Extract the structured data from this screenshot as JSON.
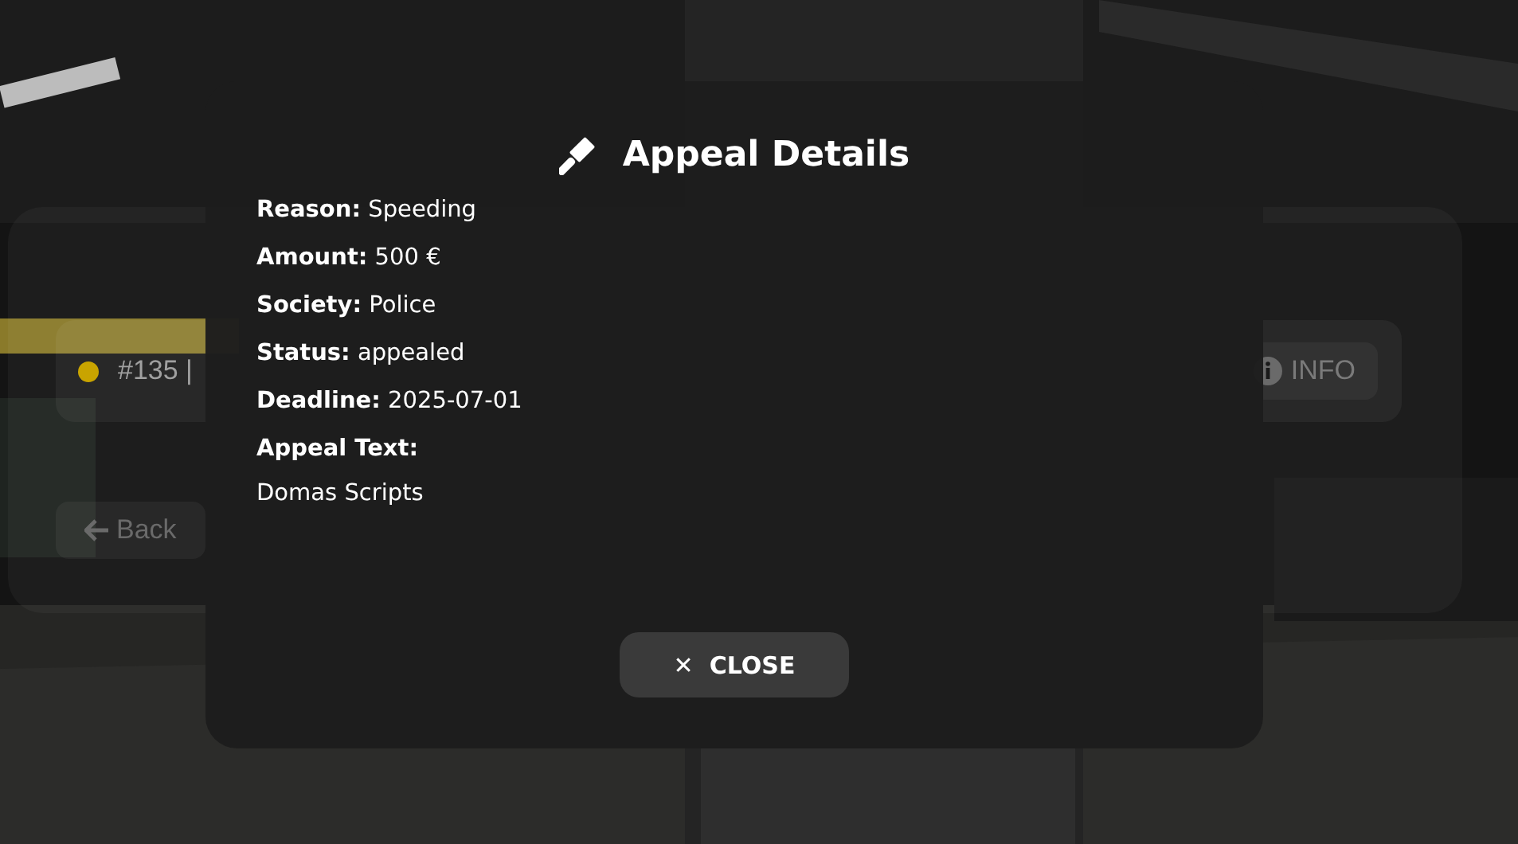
{
  "background_panel": {
    "appeals": [
      {
        "text": "#135 |",
        "color": "#c9a400",
        "button": "INFO"
      }
    ],
    "back_button": "Back"
  },
  "modal": {
    "title": "Appeal Details",
    "fields": [
      {
        "kind": "inline",
        "label": "Reason:",
        "value": "Speeding"
      },
      {
        "kind": "inline",
        "label": "Amount:",
        "value": "500 €"
      },
      {
        "kind": "inline",
        "label": "Society:",
        "value": "Police"
      },
      {
        "kind": "inline",
        "label": "Status:",
        "value": "appealed"
      },
      {
        "kind": "inline",
        "label": "Deadline:",
        "value": "2025-07-01"
      },
      {
        "kind": "block",
        "label": "Appeal Text:",
        "value": "Domas Scripts"
      }
    ],
    "close_button": {
      "icon": "✕",
      "label": "CLOSE"
    }
  }
}
